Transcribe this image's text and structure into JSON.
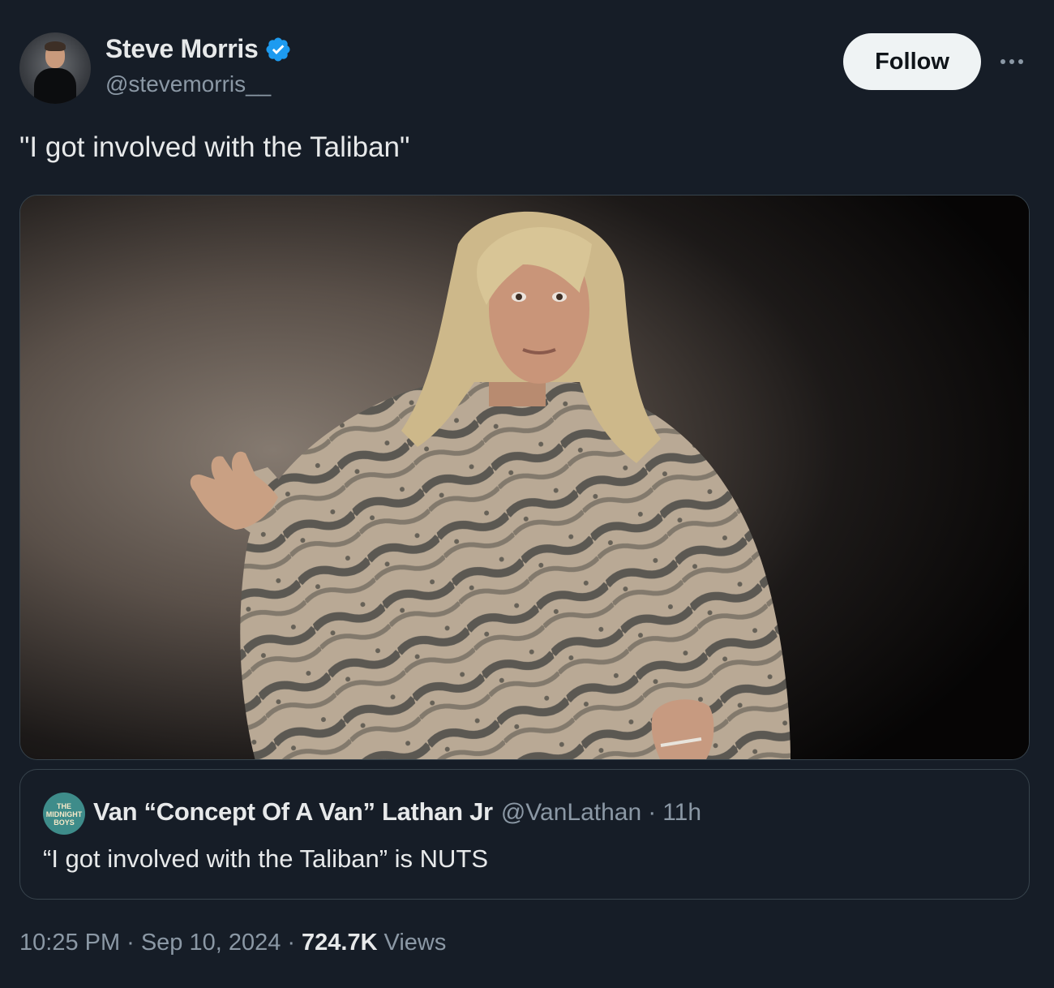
{
  "author": {
    "display_name": "Steve Morris",
    "handle": "@stevemorris__",
    "verified": true
  },
  "follow_label": "Follow",
  "tweet_text": "\"I got involved with the Taliban\"",
  "quoted": {
    "display_name": "Van “Concept Of A Van” Lathan Jr",
    "handle": "@VanLathan",
    "separator": "·",
    "time": "11h",
    "text": "“I got involved with the Taliban” is NUTS",
    "avatar_text": [
      "THE",
      "MIDNIGHT",
      "BOYS"
    ]
  },
  "meta": {
    "time": "10:25 PM",
    "separator": "·",
    "date": "Sep 10, 2024",
    "views_count": "724.7K",
    "views_label": "Views"
  },
  "colors": {
    "background": "#161d27",
    "verified_badge": "#1d9bf0",
    "follow_button": "#eff3f4",
    "secondary_text": "#8b98a5"
  },
  "icons": {
    "verified": "verified-badge-icon",
    "more": "more-horizontal-icon"
  }
}
